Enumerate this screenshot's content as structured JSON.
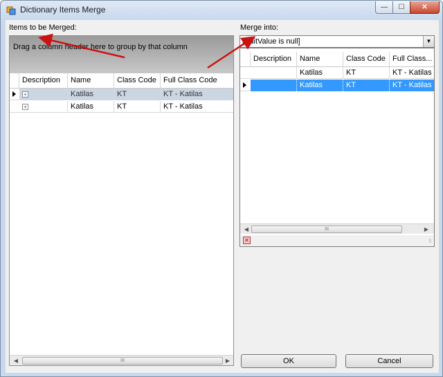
{
  "window": {
    "title": "Dictionary Items Merge",
    "controls": {
      "minimize": "—",
      "maximize": "☐",
      "close": "✕"
    }
  },
  "left": {
    "label": "Items to be Merged:",
    "group_panel_text": "Drag a column header here to group by that column",
    "columns": [
      "Description",
      "Name",
      "Class Code",
      "Full Class Code"
    ],
    "rows": [
      {
        "description": "",
        "name": "Katilas",
        "class_code": "KT",
        "full_class_code": "KT - Katilas",
        "selected": true
      },
      {
        "description": "",
        "name": "Katilas",
        "class_code": "KT",
        "full_class_code": "KT - Katilas",
        "selected": false
      }
    ],
    "scroll_left": "◀",
    "scroll_right": "▶",
    "thumb_grip": "III"
  },
  "right": {
    "label": "Merge into:",
    "combo_value": "[EditValue is null]",
    "combo_arrow": "▼",
    "columns": [
      "Description",
      "Name",
      "Class Code",
      "Full Class..."
    ],
    "rows": [
      {
        "description": "",
        "name": "Katilas",
        "class_code": "KT",
        "full_class_code": "KT - Katilas",
        "selected": false
      },
      {
        "description": "",
        "name": "Katilas",
        "class_code": "KT",
        "full_class_code": "KT - Katilas",
        "selected": true
      }
    ],
    "scroll_left": "◀",
    "scroll_right": "▶",
    "thumb_grip": "III",
    "clear_icon": "✕",
    "resize_grip": "⠿"
  },
  "buttons": {
    "ok": "OK",
    "cancel": "Cancel"
  },
  "colors": {
    "annotation_arrow": "#cc1111",
    "selection": "#3399ff"
  }
}
